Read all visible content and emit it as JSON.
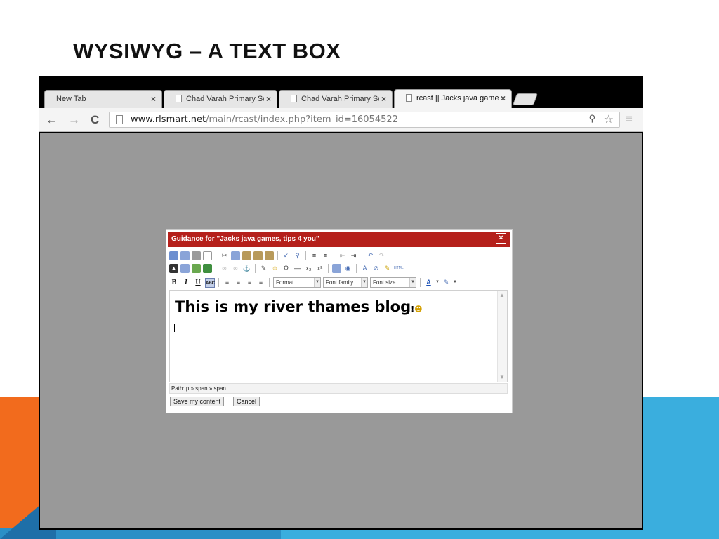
{
  "slide": {
    "title": "WYSIWYG – A TEXT BOX"
  },
  "browser": {
    "tabs": [
      {
        "label": "New Tab",
        "active": false
      },
      {
        "label": "Chad Varah Primary Sch",
        "active": false
      },
      {
        "label": "Chad Varah Primary Sch",
        "active": false
      },
      {
        "label": "rcast || Jacks java games",
        "active": true
      }
    ],
    "tab_close_glyph": "×",
    "url_host": "www.rlsmart.net",
    "url_path": "/main/rcast/index.php?item_id=16054522"
  },
  "dialog": {
    "title": "Guidance for \"Jacks java games, tips 4 you\"",
    "close_glyph": "×",
    "format_select": "Format",
    "font_family_select": "Font family",
    "font_size_select": "Font size",
    "bold_label": "B",
    "italic_label": "I",
    "underline_label": "U",
    "strike_label": "ABC",
    "content_text": "This is my river thames blog",
    "content_suffix": "!",
    "path_text": "Path: p » span » span",
    "save_label": "Save my content",
    "cancel_label": "Cancel"
  },
  "colors": {
    "dialog_header": "#b5201b",
    "viewport_bg": "#999999",
    "accent_orange": "#f26b1d",
    "accent_blue": "#3aaede"
  }
}
